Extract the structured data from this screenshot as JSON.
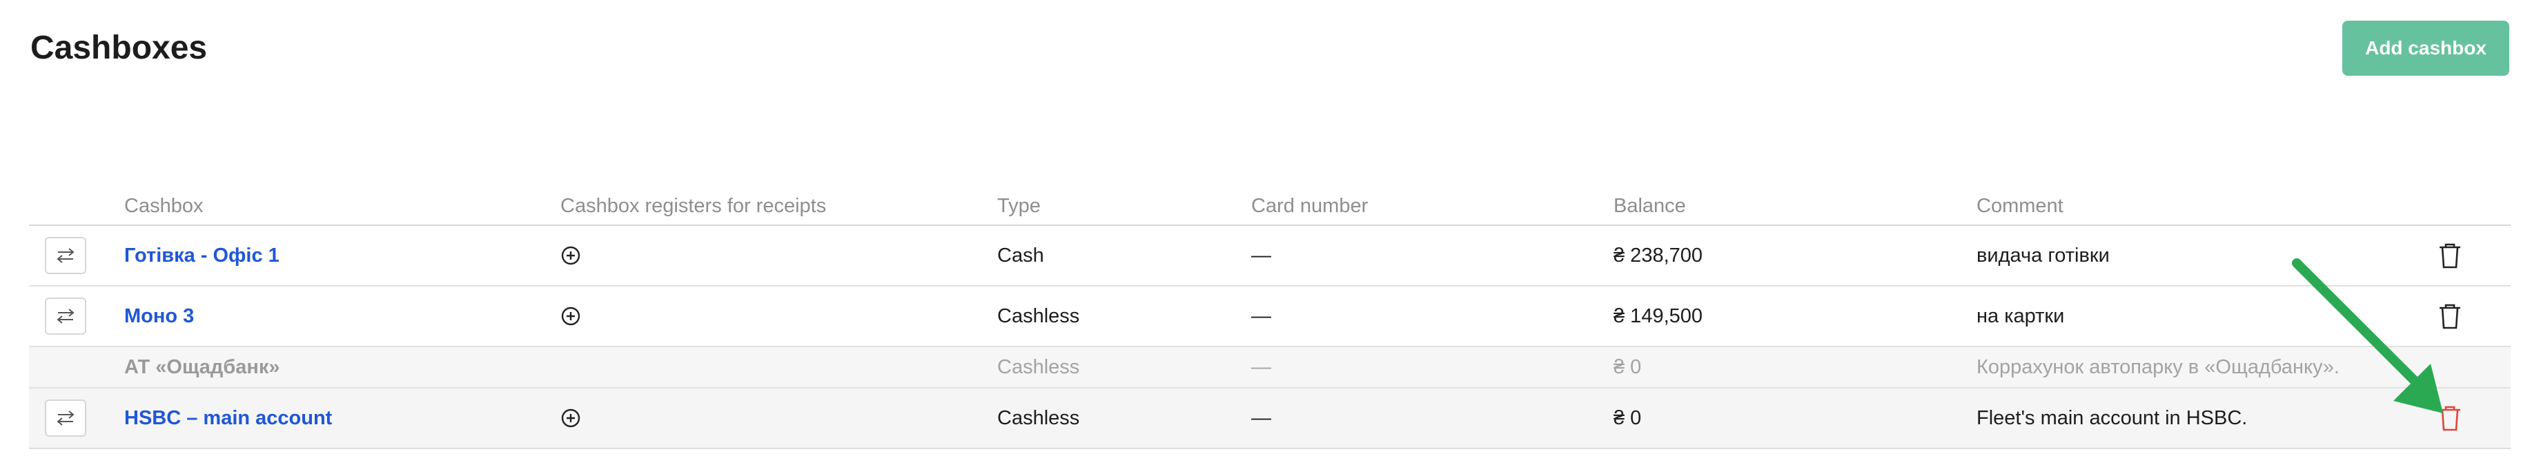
{
  "page": {
    "title": "Cashboxes",
    "add_button": "Add cashbox"
  },
  "table": {
    "headers": {
      "cashbox": "Cashbox",
      "registers": "Cashbox registers for receipts",
      "type": "Type",
      "card": "Card number",
      "balance": "Balance",
      "comment": "Comment"
    },
    "rows": [
      {
        "name": "Готівка - Офіс 1",
        "type": "Cash",
        "card": "—",
        "balance": "₴ 238,700",
        "comment": "видача готівки",
        "active": true
      },
      {
        "name": "Моно 3",
        "type": "Cashless",
        "card": "—",
        "balance": "₴ 149,500",
        "comment": "на картки",
        "active": true
      },
      {
        "name": "АТ «Ощадбанк»",
        "type": "Cashless",
        "card": "—",
        "balance": "₴ 0",
        "comment": "Коррахунок автопарку в «Ощадбанку».",
        "active": false
      },
      {
        "name": "HSBC – main account",
        "type": "Cashless",
        "card": "—",
        "balance": "₴ 0",
        "comment": "Fleet's main account in HSBC.",
        "active": true,
        "highlighted": true
      }
    ]
  },
  "icons": {
    "transfer": "transfer-arrows-icon",
    "add_register": "plus-circle-icon",
    "delete": "trash-icon",
    "annotation": "green-arrow"
  },
  "colors": {
    "accent": "#66c29e",
    "link": "#1f57d6",
    "danger": "#e0453a",
    "annotation_arrow": "#2aa952"
  }
}
